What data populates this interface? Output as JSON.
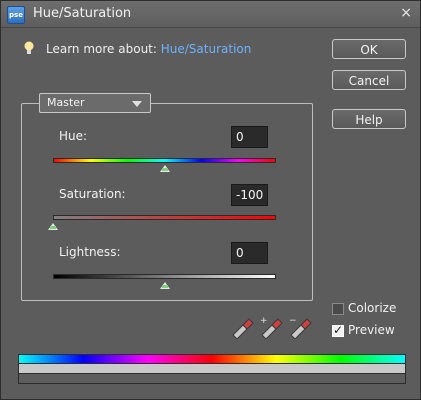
{
  "window": {
    "title": "Hue/Saturation",
    "app_icon_text": "pse",
    "close_glyph": "×"
  },
  "learn": {
    "prefix": "Learn more about:",
    "link": "Hue/Saturation"
  },
  "buttons": {
    "ok": "OK",
    "cancel": "Cancel",
    "help": "Help"
  },
  "edit_select": {
    "value": "Master"
  },
  "adjustments": {
    "hue": {
      "label": "Hue:",
      "value": "0",
      "slider_min": -180,
      "slider_max": 180
    },
    "saturation": {
      "label": "Saturation:",
      "value": "-100",
      "slider_min": -100,
      "slider_max": 100
    },
    "lightness": {
      "label": "Lightness:",
      "value": "0",
      "slider_min": -100,
      "slider_max": 100
    }
  },
  "options": {
    "colorize": {
      "label": "Colorize",
      "checked": false
    },
    "preview": {
      "label": "Preview",
      "checked": true
    }
  },
  "icons": {
    "eyedroppers": [
      "eyedropper-icon",
      "eyedropper-plus-icon",
      "eyedropper-minus-icon"
    ],
    "bulb": "lightbulb-icon"
  },
  "colors": {
    "background": "#5c5c5c",
    "link": "#6fb2ff",
    "input_bg": "#2a2a2a"
  }
}
